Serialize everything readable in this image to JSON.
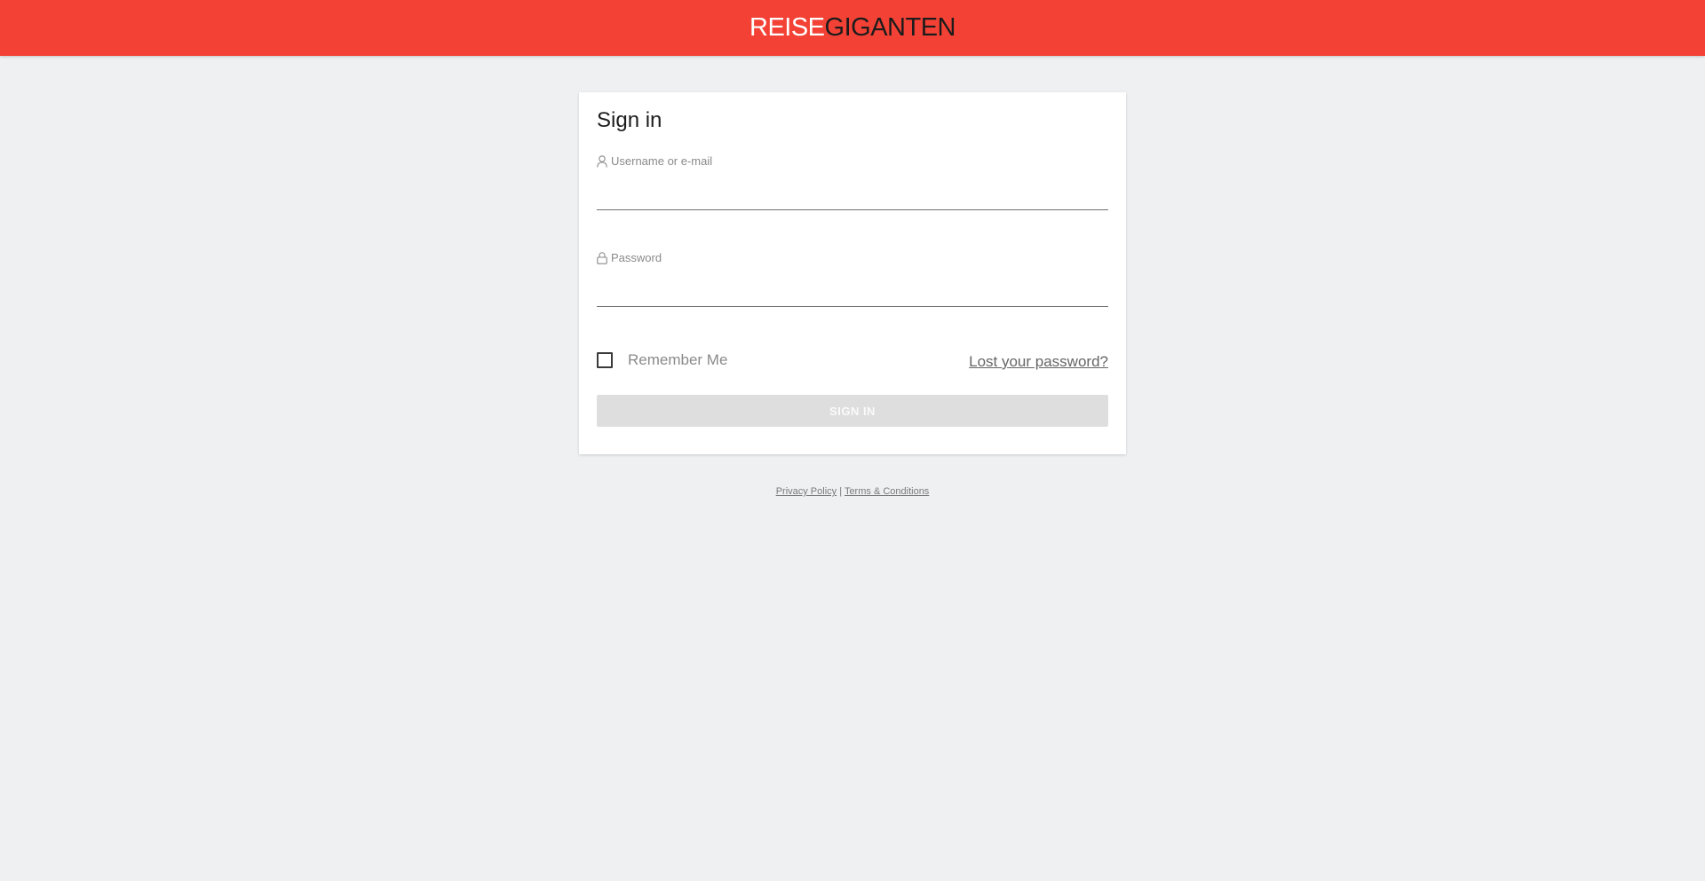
{
  "header": {
    "logo_part1": "REISE",
    "logo_part2": "GIGANTEN",
    "background_color": "#f34235"
  },
  "form": {
    "title": "Sign in",
    "username": {
      "icon": "user-icon",
      "label": "Username or e-mail",
      "value": ""
    },
    "password": {
      "icon": "lock-icon",
      "label": "Password",
      "value": ""
    },
    "remember_label": "Remember Me",
    "remember_checked": false,
    "lost_password_label": "Lost your password?",
    "submit_label": "SIGN IN"
  },
  "footer": {
    "privacy_label": "Privacy Policy",
    "separator": "|",
    "terms_label": "Terms & Conditions"
  }
}
